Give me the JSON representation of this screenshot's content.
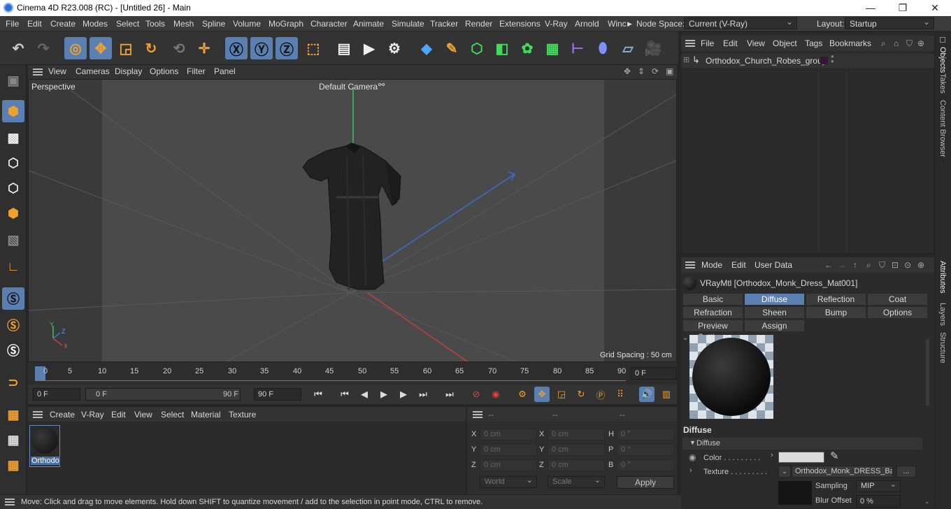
{
  "window": {
    "title": "Cinema 4D R23.008 (RC) - [Untitled 26] - Main"
  },
  "menu": [
    "File",
    "Edit",
    "Create",
    "Modes",
    "Select",
    "Tools",
    "Mesh",
    "Spline",
    "Volume",
    "MoGraph",
    "Character",
    "Animate",
    "Simulate",
    "Tracker",
    "Render",
    "Extensions",
    "V-Ray",
    "Arnold",
    "Winc"
  ],
  "menu_extra": {
    "node_space_label": "Node Space:",
    "node_space_value": "Current (V-Ray)",
    "layout_label": "Layout:",
    "layout_value": "Startup"
  },
  "viewport": {
    "menu": [
      "View",
      "Cameras",
      "Display",
      "Options",
      "Filter",
      "Panel"
    ],
    "view_name": "Perspective",
    "camera": "Default Camera",
    "grid_spacing": "Grid Spacing : 50 cm"
  },
  "timeline": {
    "ticks": [
      "0",
      "5",
      "10",
      "15",
      "20",
      "25",
      "30",
      "35",
      "40",
      "45",
      "50",
      "55",
      "60",
      "65",
      "70",
      "75",
      "80",
      "85",
      "90"
    ],
    "current_frame": "0 F",
    "start": "0 F",
    "range_start": "0 F",
    "range_end": "90 F",
    "end": "90 F"
  },
  "material_manager": {
    "menu": [
      "Create",
      "V-Ray",
      "Edit",
      "View",
      "Select",
      "Material",
      "Texture"
    ],
    "material_name": "Orthodo"
  },
  "coordinates": {
    "header": [
      "--",
      "--",
      "--"
    ],
    "rows": [
      {
        "a": "X",
        "v1": "0 cm",
        "b": "X",
        "v2": "0 cm",
        "c": "H",
        "v3": "0 °"
      },
      {
        "a": "Y",
        "v1": "0 cm",
        "b": "Y",
        "v2": "0 cm",
        "c": "P",
        "v3": "0 °"
      },
      {
        "a": "Z",
        "v1": "0 cm",
        "b": "Z",
        "v2": "0 cm",
        "c": "B",
        "v3": "0 °"
      }
    ],
    "world": "World",
    "scale": "Scale",
    "apply": "Apply"
  },
  "objects": {
    "menu": [
      "File",
      "Edit",
      "View",
      "Object",
      "Tags",
      "Bookmarks"
    ],
    "item": "Orthodox_Church_Robes_group"
  },
  "attributes": {
    "menu": [
      "Mode",
      "Edit",
      "User Data"
    ],
    "material": "VRayMtl [Orthodox_Monk_Dress_Mat001]",
    "tabs": [
      "Basic",
      "Diffuse",
      "Reflection",
      "Coat",
      "Refraction",
      "Sheen",
      "Bump",
      "Options",
      "Preview Settings",
      "Assign"
    ],
    "section": "Diffuse",
    "subsection": "Diffuse",
    "color_label": "Color . . . . . . . . .",
    "texture_label": "Texture . . . . . . . . .",
    "texture_value": "Orthodox_Monk_DRESS_Bas",
    "more": "...",
    "sampling_label": "Sampling",
    "sampling_value": "MIP",
    "blur_label": "Blur Offset",
    "blur_value": "0 %"
  },
  "side_tabs": [
    "Objects",
    "Takes",
    "Content Browser",
    "Attributes",
    "Layers",
    "Structure"
  ],
  "status": "Move: Click and drag to move elements. Hold down SHIFT to quantize movement / add to the selection in point mode, CTRL to remove."
}
